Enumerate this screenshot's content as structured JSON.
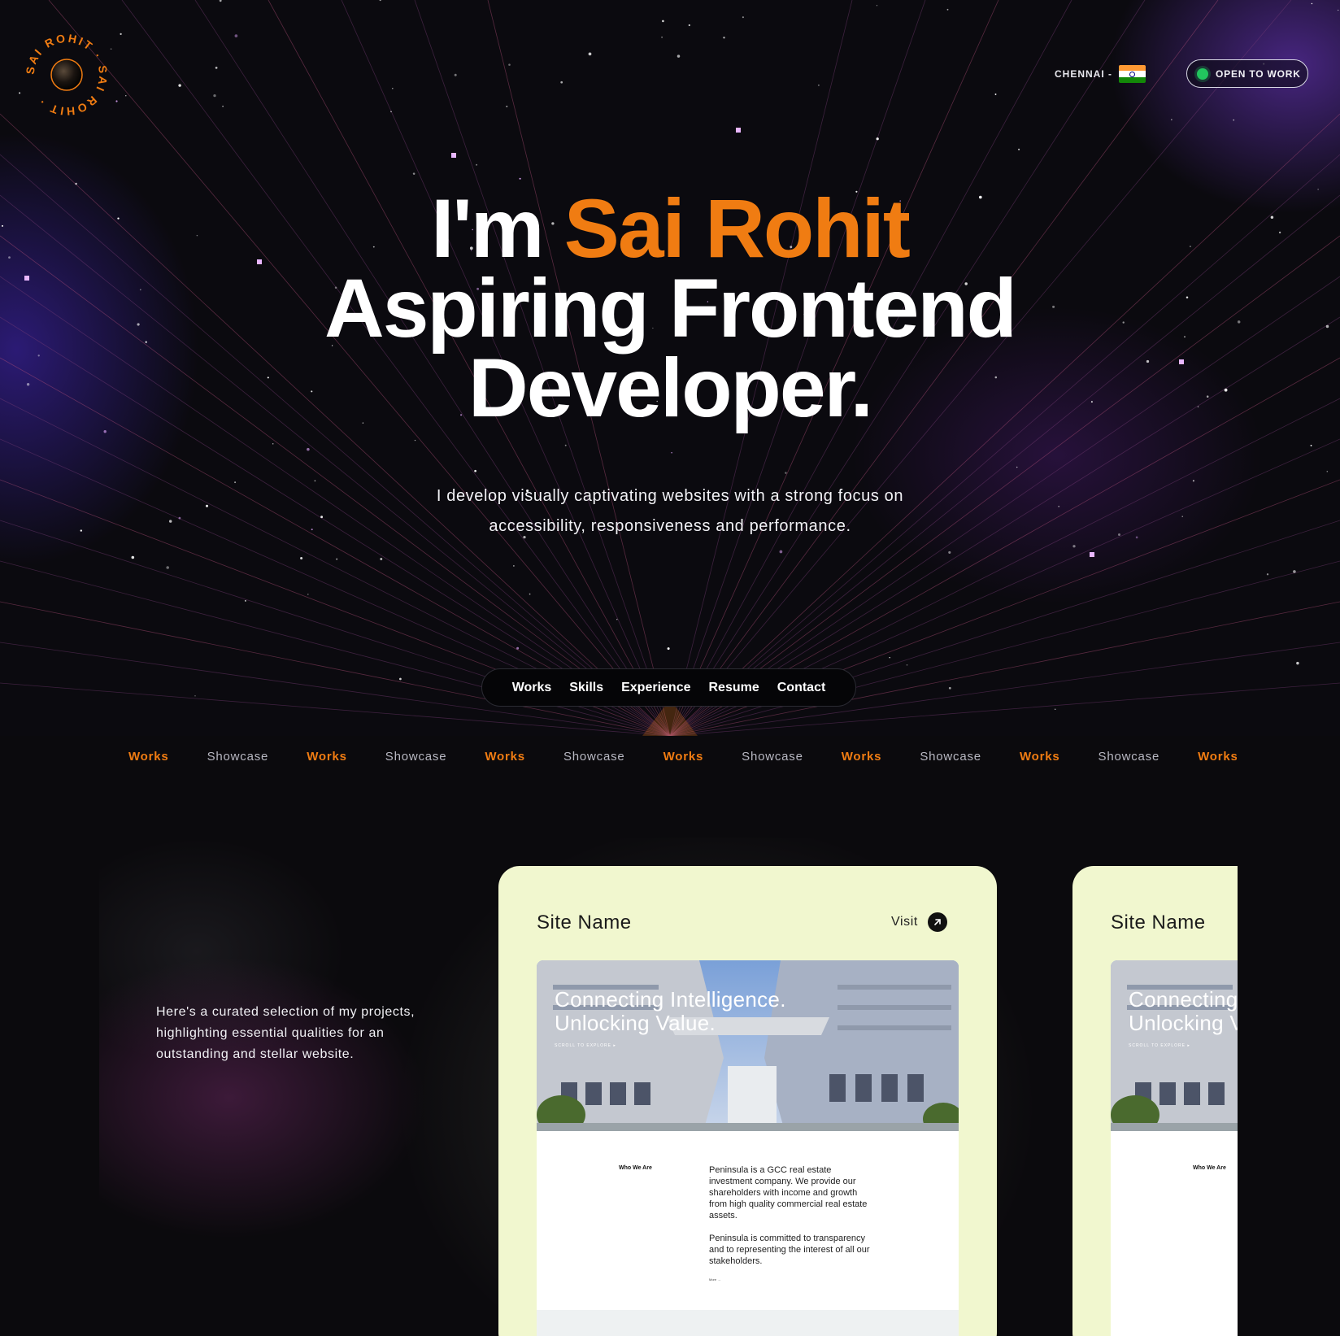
{
  "brand": {
    "ring_text": "SAI ROHIT · SAI ROHIT ·",
    "accent_color": "#f07c12",
    "bg_color": "#0b0a0d"
  },
  "header": {
    "location": "CHENNAI -",
    "flag_icon": "india-flag-icon",
    "status_label": "OPEN TO WORK",
    "status_color": "#22c55e"
  },
  "hero": {
    "greeting": "I'm",
    "name": "Sai Rohit",
    "role_line1": "Aspiring Frontend",
    "role_line2": "Developer.",
    "subtitle_line1": "I develop visually captivating websites with a strong focus on",
    "subtitle_line2": "accessibility, responsiveness and performance."
  },
  "nav": {
    "items": [
      "Works",
      "Skills",
      "Experience",
      "Resume",
      "Contact"
    ]
  },
  "marquee": {
    "items": [
      "Works",
      "Showcase",
      "Works",
      "Showcase",
      "Works",
      "Showcase",
      "Works",
      "Showcase",
      "Works",
      "Showcase",
      "Works",
      "Showcase",
      "Works"
    ]
  },
  "works": {
    "intro": "Here's a curated selection of my projects, highlighting essential qualities for an outstanding and stellar website.",
    "cards": [
      {
        "site_name": "Site Name",
        "visit_label": "Visit",
        "visit_icon": "arrow-up-right-icon",
        "preview_title_line1": "Connecting Intelligence.",
        "preview_title_line2": "Unlocking Value.",
        "preview_sub": "SCROLL TO EXPLORE ▸",
        "who_label": "Who We Are",
        "about_1": "Peninsula is a GCC real estate investment company. We provide our shareholders with income and growth from high quality commercial real estate assets.",
        "about_2": "Peninsula is committed to transparency and to representing the interest of all our stakeholders.",
        "more": "More →"
      },
      {
        "site_name": "Site Name",
        "preview_title_line1": "Connecting Intelligence.",
        "preview_title_line2": "Unlocking Value.",
        "preview_sub": "SCROLL TO EXPLORE ▸",
        "who_label": "Who We Are"
      }
    ]
  }
}
